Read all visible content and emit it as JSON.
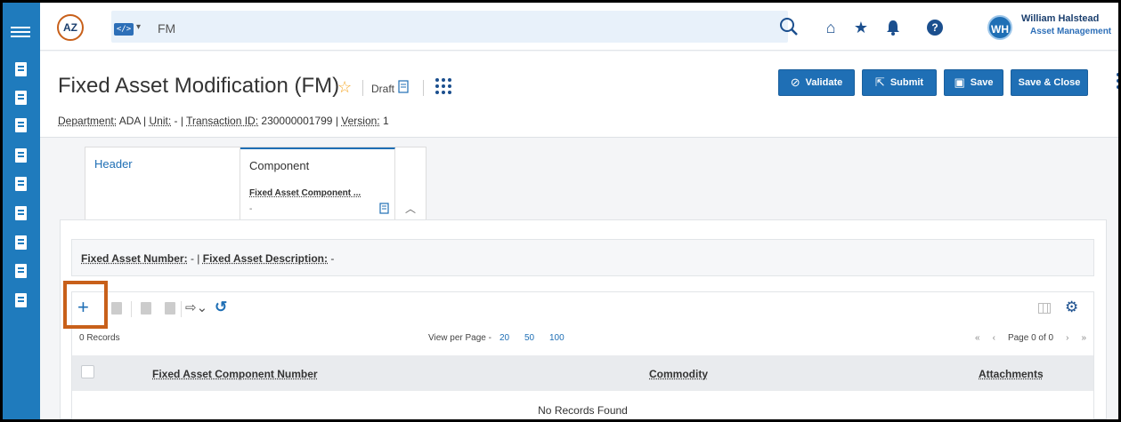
{
  "app": {
    "search_text": "FM",
    "code_badge": "</>",
    "user_name": "William Halstead",
    "user_role": "Asset Management",
    "user_initials": "WH",
    "logo_text": "AZ"
  },
  "header": {
    "title": "Fixed Asset Modification (FM)",
    "status": "Draft",
    "meta": {
      "department_label": "Department:",
      "department": "ADA",
      "unit_label": "Unit:",
      "unit": "-",
      "transaction_label": "Transaction ID:",
      "transaction_id": "230000001799",
      "version_label": "Version:",
      "version": "1"
    },
    "buttons": {
      "validate": "Validate",
      "submit": "Submit",
      "save": "Save",
      "save_close": "Save & Close"
    }
  },
  "tabs": {
    "header": "Header",
    "component": "Component",
    "component_sub": "Fixed Asset Component ...",
    "component_sub_value": "-"
  },
  "asset_info": {
    "number_label": "Fixed Asset Number:",
    "number_value": "-",
    "desc_label": "Fixed Asset Description:",
    "desc_value": "-"
  },
  "grid": {
    "records": "0 Records",
    "view_per_page": "View per Page -",
    "page_sizes": [
      "20",
      "50",
      "100"
    ],
    "page_info": "Page 0 of 0",
    "columns": [
      "Fixed Asset Component Number",
      "Commodity",
      "Attachments"
    ],
    "empty_text": "No Records Found",
    "add_symbol": "+"
  },
  "colors": {
    "rail": "#1f7bbd",
    "primary_button": "#1f6fb5",
    "highlight": "#c8601a",
    "star": "#f5a623"
  }
}
